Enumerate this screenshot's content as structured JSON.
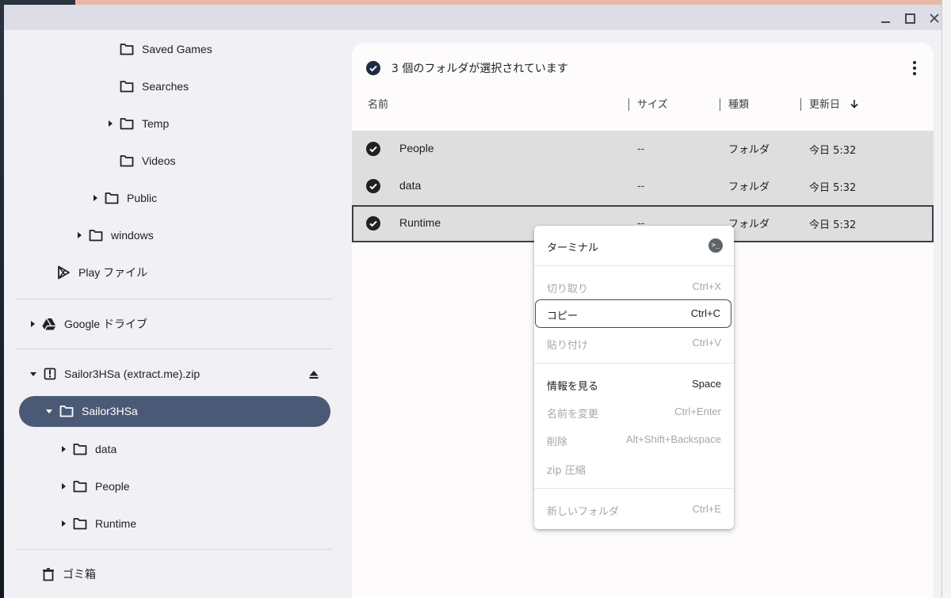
{
  "window": {
    "controls": [
      "minimize",
      "maximize",
      "close"
    ]
  },
  "sidebar": {
    "items": [
      {
        "label": "Saved Games",
        "icon": "folder-icon",
        "expandable": false
      },
      {
        "label": "Searches",
        "icon": "folder-icon",
        "expandable": false
      },
      {
        "label": "Temp",
        "icon": "folder-icon",
        "expandable": true
      },
      {
        "label": "Videos",
        "icon": "folder-icon",
        "expandable": false
      },
      {
        "label": "Public",
        "icon": "folder-icon",
        "expandable": true
      },
      {
        "label": "windows",
        "icon": "folder-icon",
        "expandable": true
      },
      {
        "label": "Play ファイル",
        "icon": "play-store-icon",
        "expandable": false
      },
      {
        "label": "Google ドライブ",
        "icon": "google-drive-icon",
        "expandable": true
      },
      {
        "label": "Sailor3HSa (extract.me).zip",
        "icon": "zip-archive-icon",
        "expandable": true,
        "expanded": true
      },
      {
        "label": "Sailor3HSa",
        "icon": "folder-icon",
        "expandable": true,
        "expanded": true,
        "selected": true
      },
      {
        "label": "data",
        "icon": "folder-icon",
        "expandable": true
      },
      {
        "label": "People",
        "icon": "folder-icon",
        "expandable": true
      },
      {
        "label": "Runtime",
        "icon": "folder-icon",
        "expandable": true
      },
      {
        "label": "ゴミ箱",
        "icon": "trash-icon",
        "expandable": false
      }
    ]
  },
  "main": {
    "selection_text": "3 個のフォルダが選択されています",
    "columns": {
      "name": "名前",
      "size": "サイズ",
      "type": "種類",
      "modified": "更新日",
      "sort": "descending"
    },
    "rows": [
      {
        "name": "People",
        "size": "--",
        "type": "フォルダ",
        "modified": "今日 5:32",
        "selected": true
      },
      {
        "name": "data",
        "size": "--",
        "type": "フォルダ",
        "modified": "今日 5:32",
        "selected": true
      },
      {
        "name": "Runtime",
        "size": "--",
        "type": "フォルダ",
        "modified": "今日 5:32",
        "selected": true
      }
    ]
  },
  "context_menu": {
    "terminal": {
      "label": "ターミナル",
      "icon": "terminal-icon"
    },
    "cut": {
      "label": "切り取り",
      "shortcut": "Ctrl+X",
      "enabled": false
    },
    "copy": {
      "label": "コピー",
      "shortcut": "Ctrl+C",
      "enabled": true,
      "focused": true
    },
    "paste": {
      "label": "貼り付け",
      "shortcut": "Ctrl+V",
      "enabled": false
    },
    "info": {
      "label": "情報を見る",
      "shortcut": "Space",
      "enabled": true
    },
    "rename": {
      "label": "名前を変更",
      "shortcut": "Ctrl+Enter",
      "enabled": false
    },
    "delete": {
      "label": "削除",
      "shortcut": "Alt+Shift+Backspace",
      "enabled": false
    },
    "zip": {
      "label": "zip 圧縮",
      "enabled": false
    },
    "new_folder": {
      "label": "新しいフォルダ",
      "shortcut": "Ctrl+E",
      "enabled": false
    }
  },
  "colors": {
    "selected_pill": "#4a5a76",
    "selected_row": "#dedede",
    "panel_bg": "#fdfbfb",
    "sidebar_bg": "#f1f1f5"
  }
}
